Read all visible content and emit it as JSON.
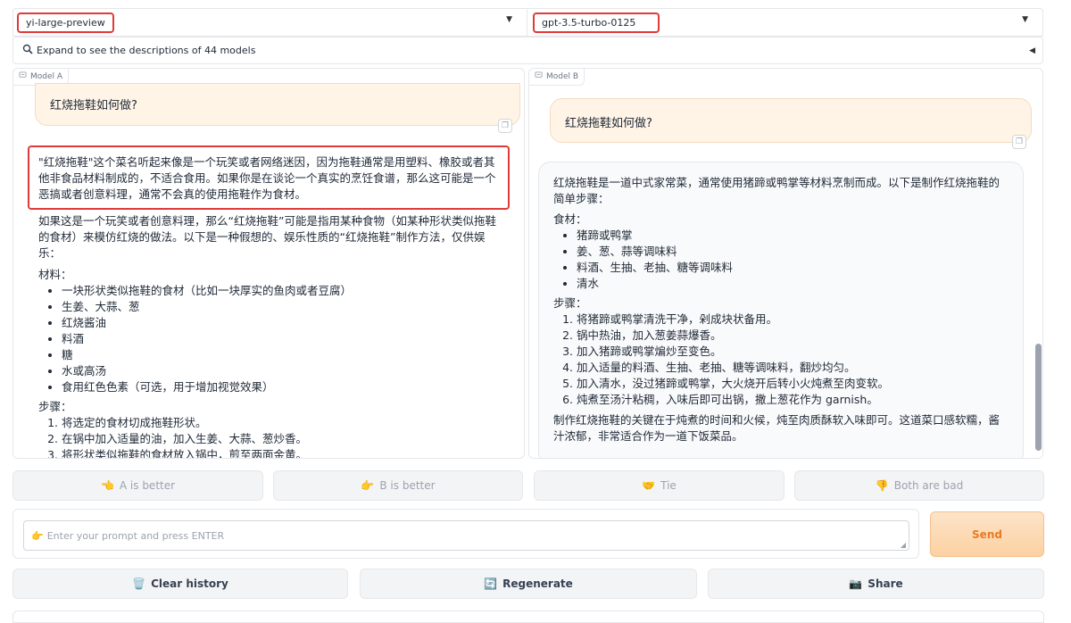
{
  "models": {
    "model_a_select": "yi-large-preview",
    "model_b_select": "gpt-3.5-turbo-0125",
    "expand_text": "Expand to see the descriptions of 44 models",
    "expand_caret": "◀"
  },
  "panel_a": {
    "tag": "Model A",
    "user_msg": "红烧拖鞋如何做?",
    "highlighted_para": "\"红烧拖鞋\"这个菜名听起来像是一个玩笑或者网络迷因，因为拖鞋通常是用塑料、橡胶或者其他非食品材料制成的，不适合食用。如果你是在谈论一个真实的烹饪食谱，那么这可能是一个恶搞或者创意料理，通常不会真的使用拖鞋作为食材。",
    "para2": "如果这是一个玩笑或者创意料理，那么“红烧拖鞋”可能是指用某种食物（如某种形状类似拖鞋的食材）来模仿红烧的做法。以下是一种假想的、娱乐性质的“红烧拖鞋”制作方法，仅供娱乐：",
    "materials_heading": "材料：",
    "materials": [
      "一块形状类似拖鞋的食材（比如一块厚实的鱼肉或者豆腐）",
      "生姜、大蒜、葱",
      "红烧酱油",
      "料酒",
      "糖",
      "水或高汤",
      "食用红色色素（可选，用于增加视觉效果）"
    ],
    "steps_heading": "步骤：",
    "steps": [
      "将选定的食材切成拖鞋形状。",
      "在锅中加入适量的油，加入生姜、大蒜、葱炒香。",
      "将形状类似拖鞋的食材放入锅中，煎至两面金黄。"
    ]
  },
  "panel_b": {
    "tag": "Model B",
    "user_msg": "红烧拖鞋如何做?",
    "intro": "红烧拖鞋是一道中式家常菜，通常使用猪蹄或鸭掌等材料烹制而成。以下是制作红烧拖鞋的简单步骤：",
    "ingredients_heading": "食材：",
    "ingredients": [
      "猪蹄或鸭掌",
      "姜、葱、蒜等调味料",
      "料酒、生抽、老抽、糖等调味料",
      "清水"
    ],
    "steps_heading": "步骤：",
    "steps": [
      "将猪蹄或鸭掌清洗干净，剁成块状备用。",
      "锅中热油，加入葱姜蒜爆香。",
      "加入猪蹄或鸭掌煸炒至变色。",
      "加入适量的料酒、生抽、老抽、糖等调味料，翻炒均匀。",
      "加入清水，没过猪蹄或鸭掌，大火烧开后转小火炖煮至肉变软。",
      "炖煮至汤汁粘稠，入味后即可出锅，撒上葱花作为 garnish。"
    ],
    "conclusion": "制作红烧拖鞋的关键在于炖煮的时间和火候，炖至肉质酥软入味即可。这道菜口感软糯，酱汁浓郁，非常适合作为一道下饭菜品。"
  },
  "votes": {
    "a_better": "A is better",
    "b_better": "B is better",
    "tie": "Tie",
    "both_bad": "Both are bad"
  },
  "input": {
    "placeholder": "Enter your prompt and press ENTER",
    "send": "Send"
  },
  "actions": {
    "clear": "Clear history",
    "regenerate": "Regenerate",
    "share": "Share"
  }
}
